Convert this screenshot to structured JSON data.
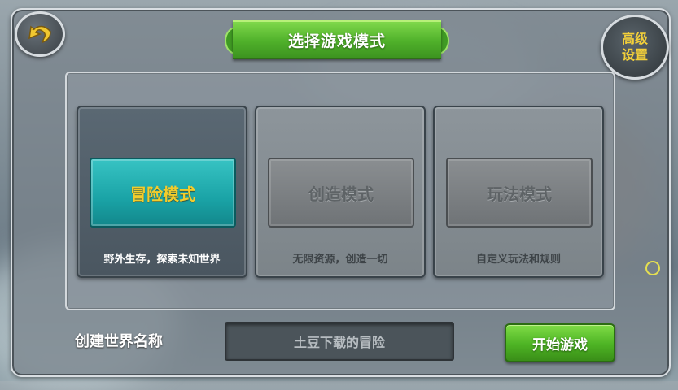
{
  "title": "选择游戏模式",
  "advanced_settings": [
    "高级",
    "设置"
  ],
  "modes": [
    {
      "label": "冒险模式",
      "description": "野外生存，探索未知世界",
      "active": true
    },
    {
      "label": "创造模式",
      "description": "无限资源，创造一切",
      "active": false
    },
    {
      "label": "玩法模式",
      "description": "自定义玩法和规则",
      "active": false
    }
  ],
  "world_name": {
    "label": "创建世界名称",
    "value": "土豆下载的冒险"
  },
  "start_button": "开始游戏",
  "colors": {
    "accent_green": "#4fb02a",
    "active_teal": "#1aa3a6",
    "active_text_gold": "#f3cc2c"
  },
  "icons": {
    "back": "back-arrow-icon"
  }
}
